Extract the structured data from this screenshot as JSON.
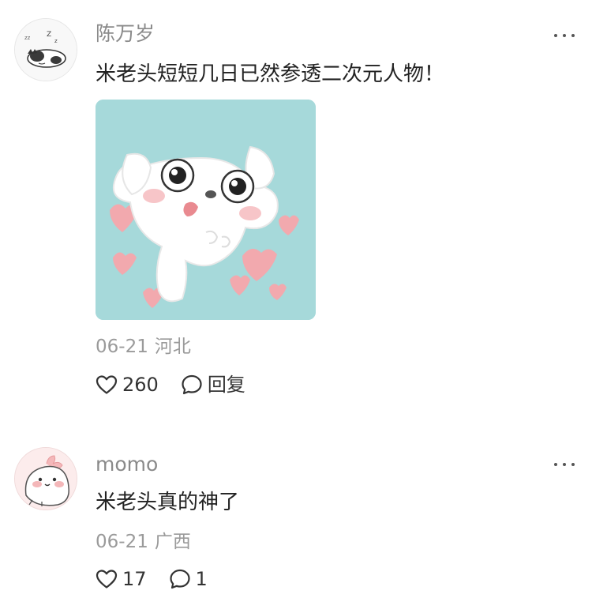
{
  "comments": [
    {
      "username": "陈万岁",
      "text": "米老头短短几日已然参透二次元人物！",
      "has_sticker": true,
      "date": "06-21",
      "location": "河北",
      "likes": "260",
      "reply_label": "回复",
      "avatar_icon": "sleeping-cat-avatar",
      "sticker_icon": "white-puppy-hearts-sticker"
    },
    {
      "username": "momo",
      "text": "米老头真的神了",
      "has_sticker": false,
      "date": "06-21",
      "location": "广西",
      "likes": "17",
      "reply_count": "1",
      "avatar_icon": "pink-blob-avatar"
    }
  ],
  "icons": {
    "like": "heart-outline-icon",
    "reply": "speech-bubble-icon",
    "more": "more-dots-icon"
  },
  "colors": {
    "username": "#8a8a8a",
    "meta": "#9a9a9a",
    "text": "#222222",
    "sticker_bg": "#a6d9da",
    "heart_pink": "#f2a9ae"
  }
}
